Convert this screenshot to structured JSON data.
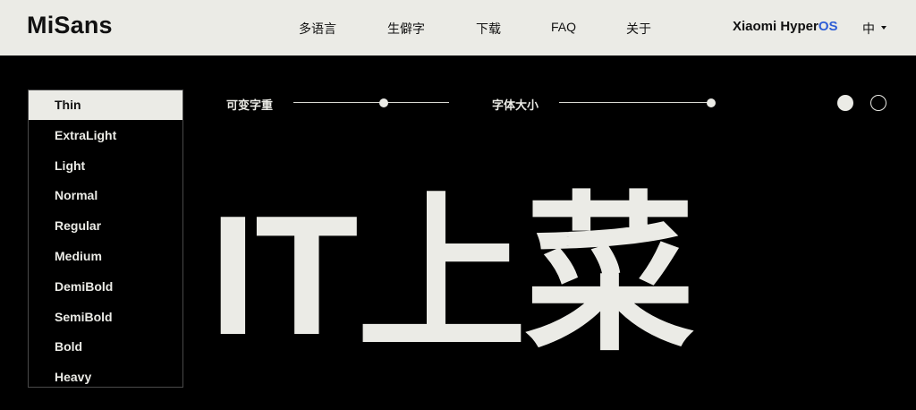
{
  "header": {
    "logo": "MiSans",
    "nav": [
      {
        "label": "多语言"
      },
      {
        "label": "生僻字"
      },
      {
        "label": "下载"
      },
      {
        "label": "FAQ"
      },
      {
        "label": "关于"
      }
    ],
    "brand_main": "Xiaomi Hyper",
    "brand_accent": "OS",
    "language": "中"
  },
  "weights": {
    "selected": "Thin",
    "items": [
      {
        "label": "Thin"
      },
      {
        "label": "ExtraLight"
      },
      {
        "label": "Light"
      },
      {
        "label": "Normal"
      },
      {
        "label": "Regular"
      },
      {
        "label": "Medium"
      },
      {
        "label": "DemiBold"
      },
      {
        "label": "SemiBold"
      },
      {
        "label": "Bold"
      },
      {
        "label": "Heavy"
      }
    ]
  },
  "controls": {
    "variable_weight_label": "可变字重",
    "variable_weight_value": 0.58,
    "font_size_label": "字体大小",
    "font_size_value": 1.0
  },
  "theme": {
    "options": [
      "light",
      "dark"
    ]
  },
  "preview": {
    "text": "IT上菜"
  },
  "colors": {
    "header_bg": "#ebebe6",
    "page_bg": "#000000",
    "foreground": "#ebebe6",
    "accent": "#2e5ed6"
  }
}
